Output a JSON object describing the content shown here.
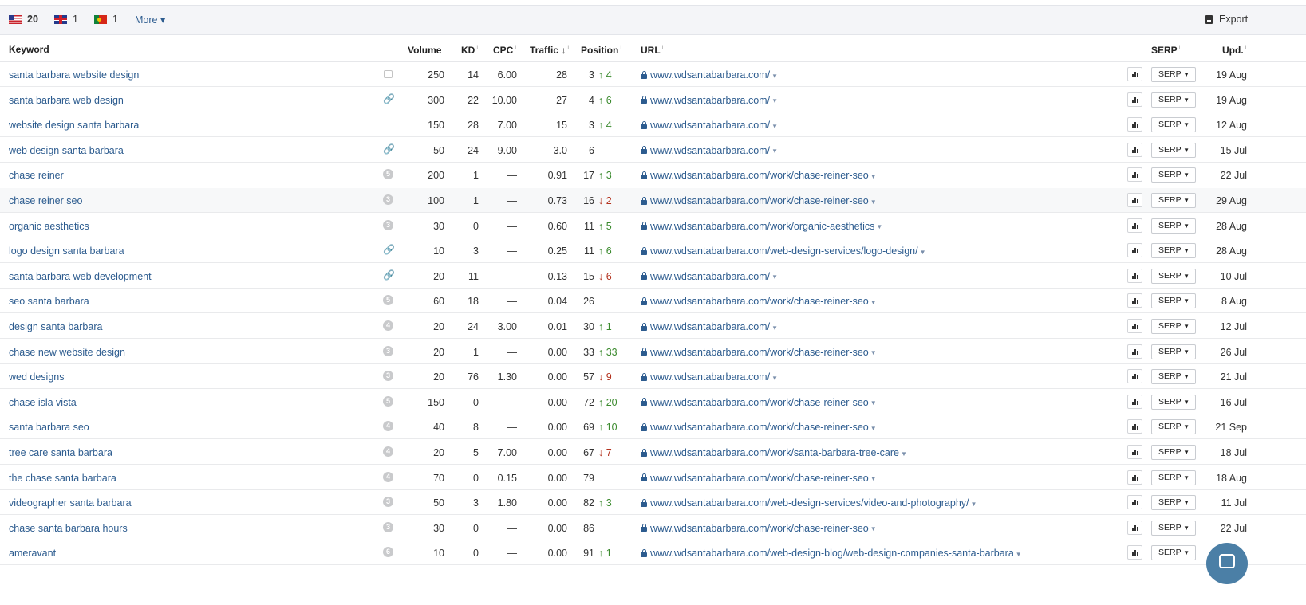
{
  "toolbar": {
    "countries": [
      {
        "code": "us",
        "count": "20"
      },
      {
        "code": "gb",
        "count": "1"
      },
      {
        "code": "pt",
        "count": "1"
      }
    ],
    "more_label": "More ▾",
    "export_label": "Export"
  },
  "headers": {
    "keyword": "Keyword",
    "volume": "Volume",
    "kd": "KD",
    "cpc": "CPC",
    "traffic": "Traffic ↓",
    "position": "Position",
    "url": "URL",
    "serp": "SERP",
    "upd": "Upd.",
    "info_mark": "i"
  },
  "serp_button_label": "SERP",
  "rows": [
    {
      "keyword": "santa barbara website design",
      "feature": "image",
      "volume": "250",
      "kd": "14",
      "cpc": "6.00",
      "traffic": "28",
      "position": "3",
      "change": "↑ 4",
      "dir": "up",
      "url": "www.wdsantabarbara.com/",
      "updated": "19 Aug"
    },
    {
      "keyword": "santa barbara web design",
      "feature": "link",
      "volume": "300",
      "kd": "22",
      "cpc": "10.00",
      "traffic": "27",
      "position": "4",
      "change": "↑ 6",
      "dir": "up",
      "url": "www.wdsantabarbara.com/",
      "updated": "19 Aug"
    },
    {
      "keyword": "website design santa barbara",
      "feature": "",
      "volume": "150",
      "kd": "28",
      "cpc": "7.00",
      "traffic": "15",
      "position": "3",
      "change": "↑ 4",
      "dir": "up",
      "url": "www.wdsantabarbara.com/",
      "updated": "12 Aug"
    },
    {
      "keyword": "web design santa barbara",
      "feature": "link",
      "volume": "50",
      "kd": "24",
      "cpc": "9.00",
      "traffic": "3.0",
      "position": "6",
      "change": "",
      "dir": "",
      "url": "www.wdsantabarbara.com/",
      "updated": "15 Jul"
    },
    {
      "keyword": "chase reiner",
      "feature": "5",
      "volume": "200",
      "kd": "1",
      "cpc": "—",
      "traffic": "0.91",
      "position": "17",
      "change": "↑ 3",
      "dir": "up",
      "url": "www.wdsantabarbara.com/work/chase-reiner-seo",
      "updated": "22 Jul"
    },
    {
      "keyword": "chase reiner seo",
      "feature": "3",
      "volume": "100",
      "kd": "1",
      "cpc": "—",
      "traffic": "0.73",
      "position": "16",
      "change": "↓ 2",
      "dir": "dn",
      "url": "www.wdsantabarbara.com/work/chase-reiner-seo",
      "updated": "29 Aug"
    },
    {
      "keyword": "organic aesthetics",
      "feature": "3",
      "volume": "30",
      "kd": "0",
      "cpc": "—",
      "traffic": "0.60",
      "position": "11",
      "change": "↑ 5",
      "dir": "up",
      "url": "www.wdsantabarbara.com/work/organic-aesthetics",
      "updated": "28 Aug"
    },
    {
      "keyword": "logo design santa barbara",
      "feature": "link",
      "volume": "10",
      "kd": "3",
      "cpc": "—",
      "traffic": "0.25",
      "position": "11",
      "change": "↑ 6",
      "dir": "up",
      "url": "www.wdsantabarbara.com/web-design-services/logo-design/",
      "updated": "28 Aug"
    },
    {
      "keyword": "santa barbara web development",
      "feature": "link",
      "volume": "20",
      "kd": "11",
      "cpc": "—",
      "traffic": "0.13",
      "position": "15",
      "change": "↓ 6",
      "dir": "dn",
      "url": "www.wdsantabarbara.com/",
      "updated": "10 Jul"
    },
    {
      "keyword": "seo santa barbara",
      "feature": "5",
      "volume": "60",
      "kd": "18",
      "cpc": "—",
      "traffic": "0.04",
      "position": "26",
      "change": "",
      "dir": "",
      "url": "www.wdsantabarbara.com/work/chase-reiner-seo",
      "updated": "8 Aug"
    },
    {
      "keyword": "design santa barbara",
      "feature": "4",
      "volume": "20",
      "kd": "24",
      "cpc": "3.00",
      "traffic": "0.01",
      "position": "30",
      "change": "↑ 1",
      "dir": "up",
      "url": "www.wdsantabarbara.com/",
      "updated": "12 Jul"
    },
    {
      "keyword": "chase new website design",
      "feature": "3",
      "volume": "20",
      "kd": "1",
      "cpc": "—",
      "traffic": "0.00",
      "position": "33",
      "change": "↑ 33",
      "dir": "up",
      "url": "www.wdsantabarbara.com/work/chase-reiner-seo",
      "updated": "26 Jul"
    },
    {
      "keyword": "wed designs",
      "feature": "3",
      "volume": "20",
      "kd": "76",
      "cpc": "1.30",
      "traffic": "0.00",
      "position": "57",
      "change": "↓ 9",
      "dir": "dn",
      "url": "www.wdsantabarbara.com/",
      "updated": "21 Jul"
    },
    {
      "keyword": "chase isla vista",
      "feature": "5",
      "volume": "150",
      "kd": "0",
      "cpc": "—",
      "traffic": "0.00",
      "position": "72",
      "change": "↑ 20",
      "dir": "up",
      "url": "www.wdsantabarbara.com/work/chase-reiner-seo",
      "updated": "16 Jul"
    },
    {
      "keyword": "santa barbara seo",
      "feature": "4",
      "volume": "40",
      "kd": "8",
      "cpc": "—",
      "traffic": "0.00",
      "position": "69",
      "change": "↑ 10",
      "dir": "up",
      "url": "www.wdsantabarbara.com/work/chase-reiner-seo",
      "updated": "21 Sep"
    },
    {
      "keyword": "tree care santa barbara",
      "feature": "4",
      "volume": "20",
      "kd": "5",
      "cpc": "7.00",
      "traffic": "0.00",
      "position": "67",
      "change": "↓ 7",
      "dir": "dn",
      "url": "www.wdsantabarbara.com/work/santa-barbara-tree-care",
      "updated": "18 Jul"
    },
    {
      "keyword": "the chase santa barbara",
      "feature": "4",
      "volume": "70",
      "kd": "0",
      "cpc": "0.15",
      "traffic": "0.00",
      "position": "79",
      "change": "",
      "dir": "",
      "url": "www.wdsantabarbara.com/work/chase-reiner-seo",
      "updated": "18 Aug"
    },
    {
      "keyword": "videographer santa barbara",
      "feature": "3",
      "volume": "50",
      "kd": "3",
      "cpc": "1.80",
      "traffic": "0.00",
      "position": "82",
      "change": "↑ 3",
      "dir": "up",
      "url": "www.wdsantabarbara.com/web-design-services/video-and-photography/",
      "updated": "11 Jul"
    },
    {
      "keyword": "chase santa barbara hours",
      "feature": "3",
      "volume": "30",
      "kd": "0",
      "cpc": "—",
      "traffic": "0.00",
      "position": "86",
      "change": "",
      "dir": "",
      "url": "www.wdsantabarbara.com/work/chase-reiner-seo",
      "updated": "22 Jul"
    },
    {
      "keyword": "ameravant",
      "feature": "6",
      "volume": "10",
      "kd": "0",
      "cpc": "—",
      "traffic": "0.00",
      "position": "91",
      "change": "↑ 1",
      "dir": "up",
      "url": "www.wdsantabarbara.com/web-design-blog/web-design-companies-santa-barbara",
      "updated": ""
    }
  ]
}
